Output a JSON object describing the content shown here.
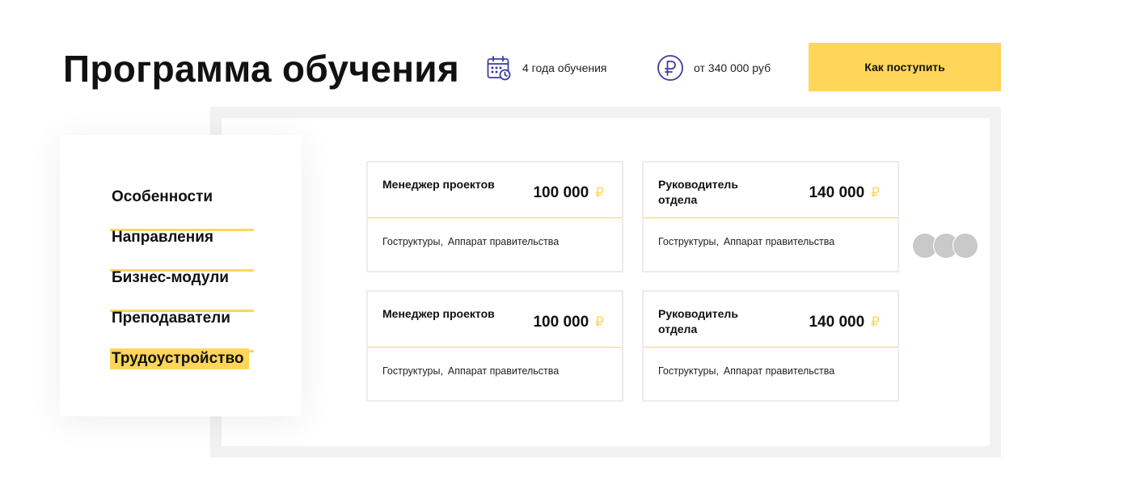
{
  "header": {
    "title": "Программа обучения",
    "duration": {
      "icon": "calendar-clock-icon",
      "text": "4 года обучения"
    },
    "price": {
      "icon": "ruble-icon",
      "text": "от 340 000 руб"
    },
    "apply_label": "Как поступить"
  },
  "menu": {
    "items": [
      {
        "label": "Особенности",
        "active": false
      },
      {
        "label": "Направления",
        "active": false
      },
      {
        "label": "Бизнес-модули",
        "active": false
      },
      {
        "label": "Преподаватели",
        "active": false
      },
      {
        "label": "Трудоустройство",
        "active": true
      }
    ]
  },
  "cards": [
    {
      "title": "Менеджер проектов",
      "salary": "100 000",
      "currency": "₽",
      "tags": [
        "Гоструктуры,",
        "Аппарат правительства"
      ]
    },
    {
      "title": "Руководитель отдела",
      "salary": "140 000",
      "currency": "₽",
      "tags": [
        "Гоструктуры,",
        "Аппарат правительства"
      ]
    },
    {
      "title": "Менеджер проектов",
      "salary": "100 000",
      "currency": "₽",
      "tags": [
        "Гоструктуры,",
        "Аппарат правительства"
      ]
    },
    {
      "title": "Руководитель отдела",
      "salary": "140 000",
      "currency": "₽",
      "tags": [
        "Гоструктуры,",
        "Аппарат правительства"
      ]
    }
  ],
  "colors": {
    "accent": "#ffd659",
    "icon": "#3a3fa0",
    "card_border": "#ececec",
    "dots": "#c9c9c9"
  },
  "more_control": {
    "icon": "more-dots-icon"
  }
}
